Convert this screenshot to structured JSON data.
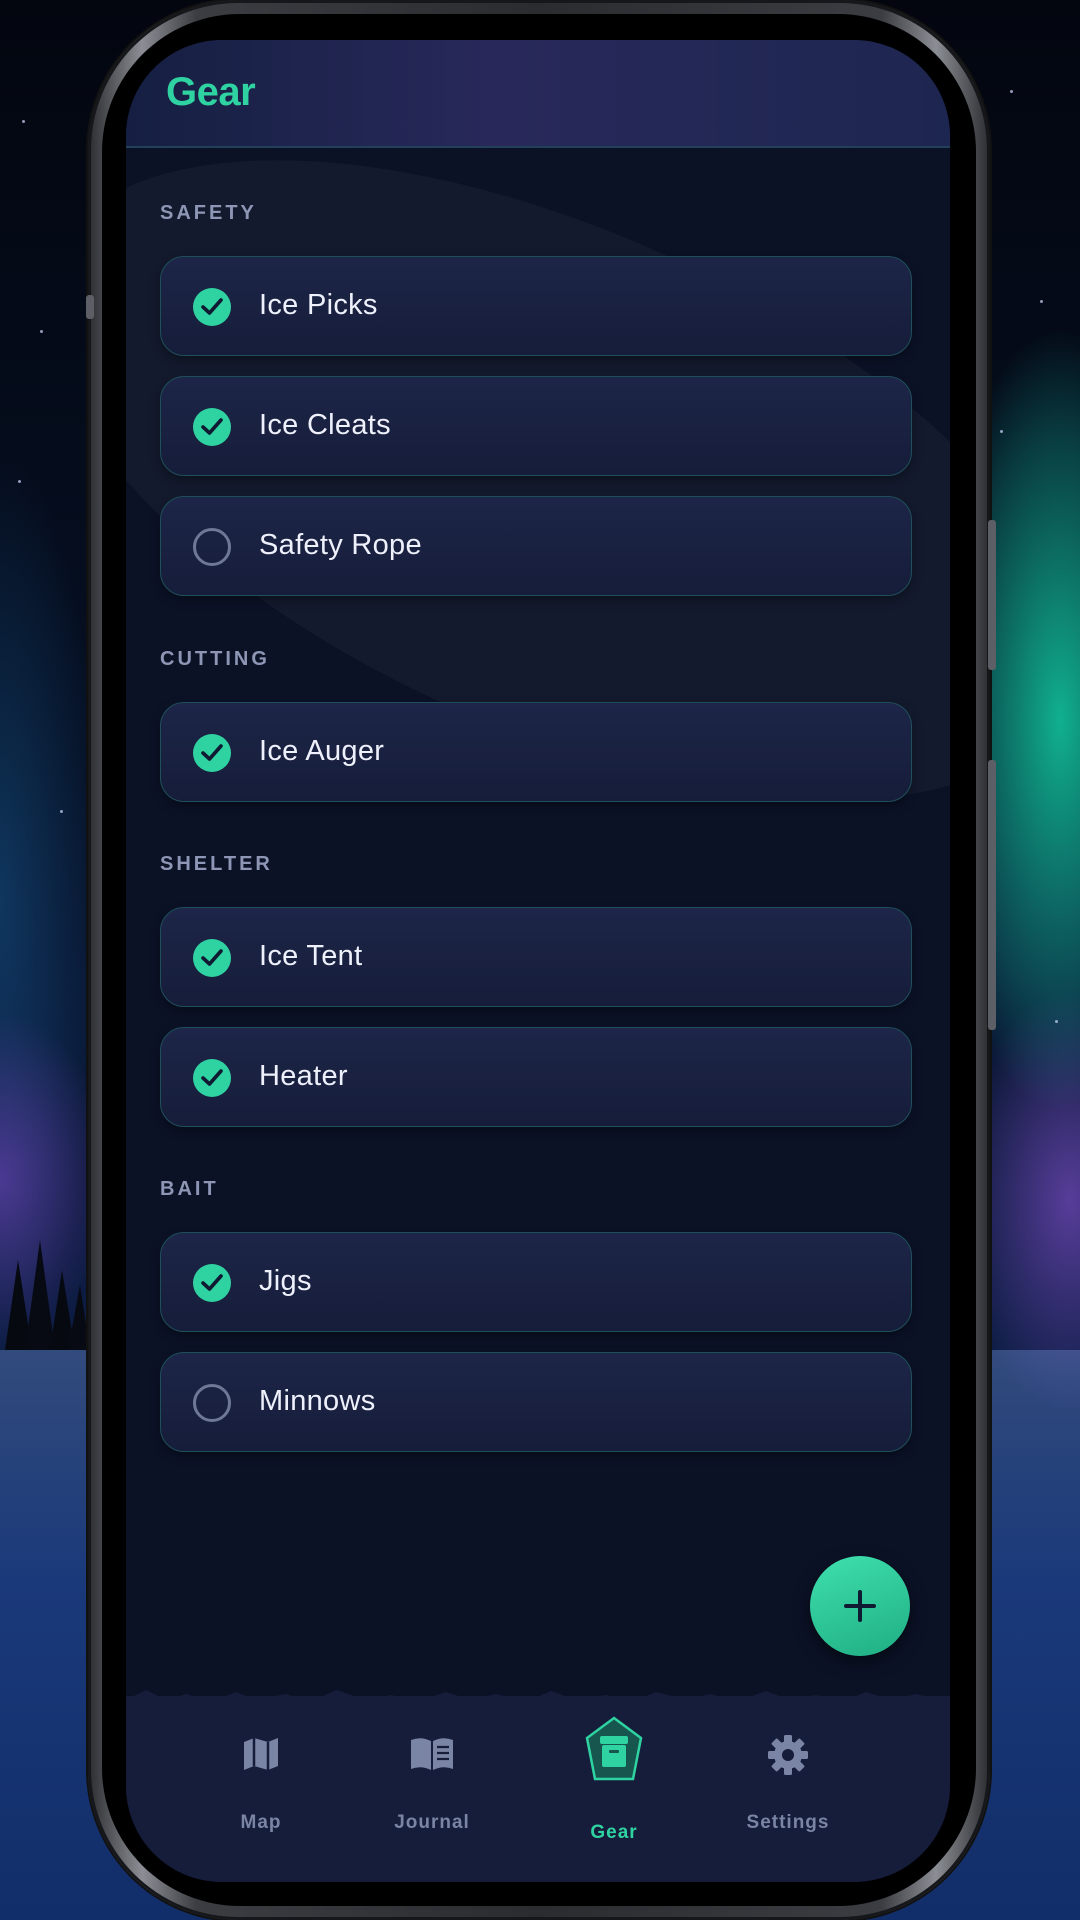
{
  "header": {
    "title": "Gear"
  },
  "sections": [
    {
      "label": "SAFETY",
      "items": [
        {
          "label": "Ice Picks",
          "checked": true
        },
        {
          "label": "Ice Cleats",
          "checked": true
        },
        {
          "label": "Safety Rope",
          "checked": false
        }
      ]
    },
    {
      "label": "CUTTING",
      "items": [
        {
          "label": "Ice Auger",
          "checked": true
        }
      ]
    },
    {
      "label": "SHELTER",
      "items": [
        {
          "label": "Ice Tent",
          "checked": true
        },
        {
          "label": "Heater",
          "checked": true
        }
      ]
    },
    {
      "label": "BAIT",
      "items": [
        {
          "label": "Jigs",
          "checked": true
        },
        {
          "label": "Minnows",
          "checked": false
        }
      ]
    }
  ],
  "fab": {
    "icon": "plus-icon"
  },
  "nav": {
    "items": [
      {
        "label": "Map",
        "icon": "map-icon",
        "active": false
      },
      {
        "label": "Journal",
        "icon": "book-icon",
        "active": false
      },
      {
        "label": "Gear",
        "icon": "gear-box-icon",
        "active": true
      },
      {
        "label": "Settings",
        "icon": "settings-cog-icon",
        "active": false
      }
    ]
  },
  "colors": {
    "accent": "#2fd3a1",
    "background": "#0b1226",
    "card": "#1d2548",
    "muted": "#7a84a4"
  }
}
